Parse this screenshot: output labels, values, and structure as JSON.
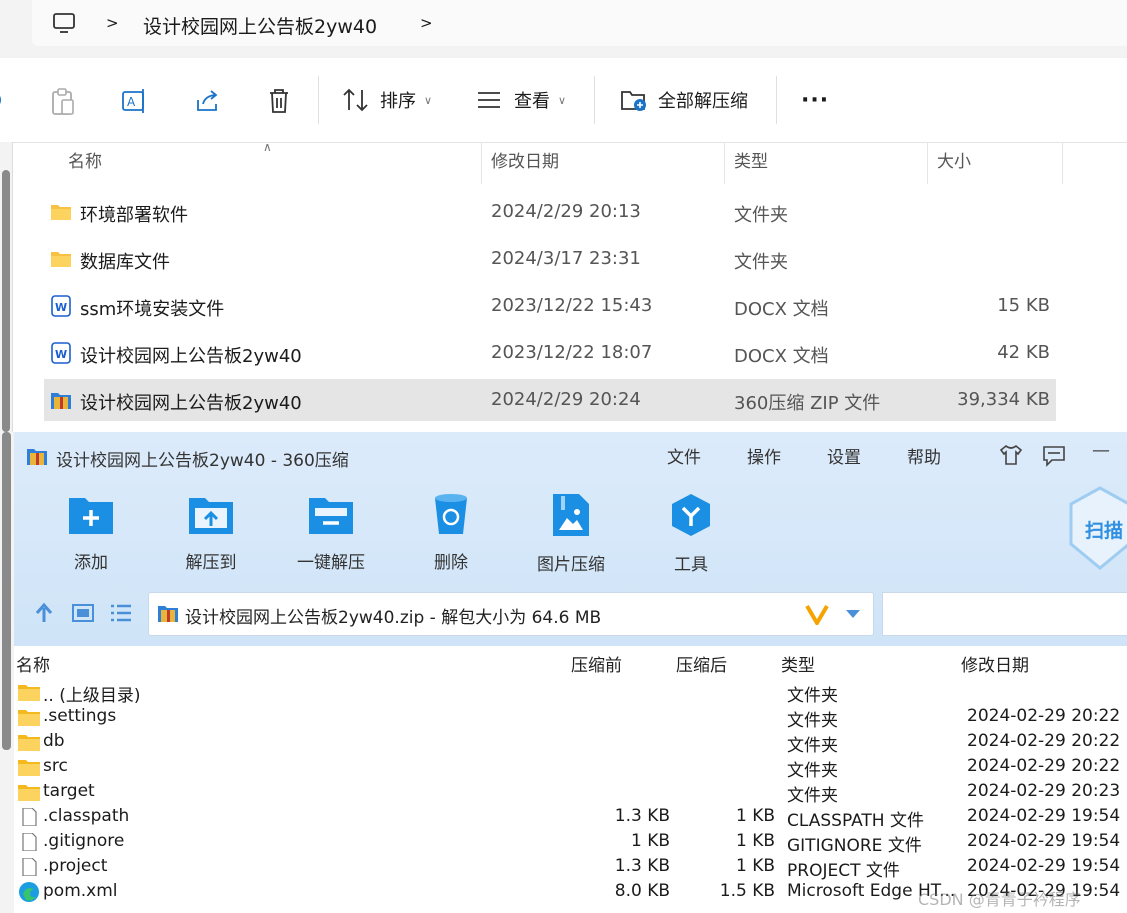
{
  "explorer": {
    "breadcrumb": {
      "folder": "设计校园网上公告板2yw40"
    },
    "toolbar": {
      "sort": "排序",
      "view": "查看",
      "extract_all": "全部解压缩"
    },
    "columns": {
      "name": "名称",
      "modified": "修改日期",
      "type": "类型",
      "size": "大小"
    },
    "files": [
      {
        "icon": "folder-icon",
        "name": "环境部署软件",
        "modified": "2024/2/29 20:13",
        "type": "文件夹",
        "size": ""
      },
      {
        "icon": "folder-icon",
        "name": "数据库文件",
        "modified": "2024/3/17 23:31",
        "type": "文件夹",
        "size": ""
      },
      {
        "icon": "docx-icon",
        "name": "ssm环境安装文件",
        "modified": "2023/12/22 15:43",
        "type": "DOCX 文档",
        "size": "15 KB"
      },
      {
        "icon": "docx-icon",
        "name": "设计校园网上公告板2yw40",
        "modified": "2023/12/22 18:07",
        "type": "DOCX 文档",
        "size": "42 KB"
      },
      {
        "icon": "zip-icon",
        "name": "设计校园网上公告板2yw40",
        "modified": "2024/2/29 20:24",
        "type": "360压缩 ZIP 文件",
        "size": "39,334 KB"
      }
    ]
  },
  "zip": {
    "title": "设计校园网上公告板2yw40 - 360压缩",
    "menu": [
      "文件",
      "操作",
      "设置",
      "帮助"
    ],
    "tools": [
      "添加",
      "解压到",
      "一键解压",
      "删除",
      "图片压缩",
      "工具"
    ],
    "scan": "扫描",
    "path": "设计校园网上公告板2yw40.zip - 解包大小为 64.6 MB",
    "columns": {
      "name": "名称",
      "packed": "压缩前",
      "compressed": "压缩后",
      "type": "类型",
      "modified": "修改日期"
    },
    "entries": [
      {
        "icon": "folder-icon",
        "name": ".. (上级目录)",
        "packed": "",
        "compressed": "",
        "type": "文件夹",
        "modified": ""
      },
      {
        "icon": "folder-icon",
        "name": ".settings",
        "packed": "",
        "compressed": "",
        "type": "文件夹",
        "modified": "2024-02-29 20:22"
      },
      {
        "icon": "folder-icon",
        "name": "db",
        "packed": "",
        "compressed": "",
        "type": "文件夹",
        "modified": "2024-02-29 20:22"
      },
      {
        "icon": "folder-icon",
        "name": "src",
        "packed": "",
        "compressed": "",
        "type": "文件夹",
        "modified": "2024-02-29 20:22"
      },
      {
        "icon": "folder-icon",
        "name": "target",
        "packed": "",
        "compressed": "",
        "type": "文件夹",
        "modified": "2024-02-29 20:23"
      },
      {
        "icon": "file-icon",
        "name": ".classpath",
        "packed": "1.3 KB",
        "compressed": "1 KB",
        "type": "CLASSPATH 文件",
        "modified": "2024-02-29 19:54"
      },
      {
        "icon": "file-icon",
        "name": ".gitignore",
        "packed": "1 KB",
        "compressed": "1 KB",
        "type": "GITIGNORE 文件",
        "modified": "2024-02-29 19:54"
      },
      {
        "icon": "file-icon",
        "name": ".project",
        "packed": "1.3 KB",
        "compressed": "1 KB",
        "type": "PROJECT 文件",
        "modified": "2024-02-29 19:54"
      },
      {
        "icon": "edge-icon",
        "name": "pom.xml",
        "packed": "8.0 KB",
        "compressed": "1.5 KB",
        "type": "Microsoft Edge HT...",
        "modified": "2024-02-29 19:54"
      }
    ]
  },
  "watermark": "CSDN @青青子衿程序",
  "colors": {
    "accent": "#1a8fe3",
    "folder": "#f7c244",
    "zip_bg": "#d6e8f9"
  }
}
